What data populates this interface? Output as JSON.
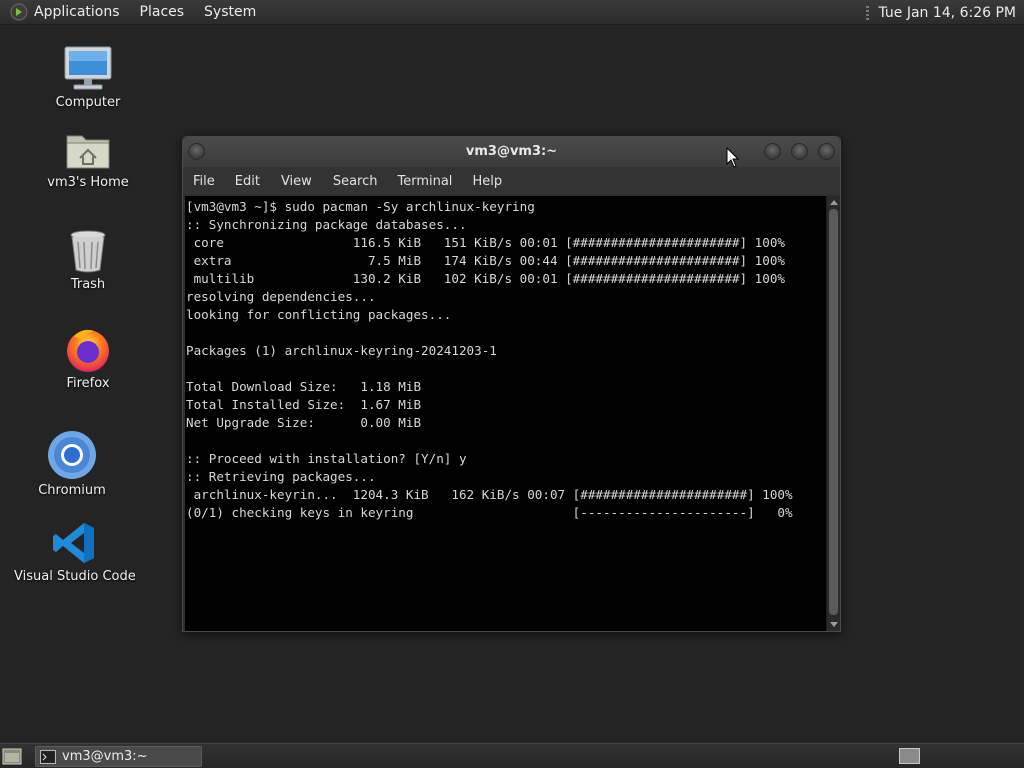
{
  "top_panel": {
    "logo_icon": "gnome-foot-icon",
    "menus": [
      "Applications",
      "Places",
      "System"
    ],
    "clock": "Tue Jan 14,  6:26 PM"
  },
  "desktop_icons": [
    {
      "label": "Computer",
      "icon": "computer-icon"
    },
    {
      "label": "vm3's Home",
      "icon": "home-folder-icon"
    },
    {
      "label": "Trash",
      "icon": "trash-icon"
    },
    {
      "label": "Firefox",
      "icon": "firefox-icon"
    },
    {
      "label": "Chromium",
      "icon": "chromium-icon"
    },
    {
      "label": "Visual Studio Code",
      "icon": "vscode-icon"
    }
  ],
  "terminal": {
    "title": "vm3@vm3:~",
    "menu": [
      "File",
      "Edit",
      "View",
      "Search",
      "Terminal",
      "Help"
    ],
    "lines": [
      "[vm3@vm3 ~]$ sudo pacman -Sy archlinux-keyring",
      ":: Synchronizing package databases...",
      " core                 116.5 KiB   151 KiB/s 00:01 [######################] 100%",
      " extra                  7.5 MiB   174 KiB/s 00:44 [######################] 100%",
      " multilib             130.2 KiB   102 KiB/s 00:01 [######################] 100%",
      "resolving dependencies...",
      "looking for conflicting packages...",
      "",
      "Packages (1) archlinux-keyring-20241203-1",
      "",
      "Total Download Size:   1.18 MiB",
      "Total Installed Size:  1.67 MiB",
      "Net Upgrade Size:      0.00 MiB",
      "",
      ":: Proceed with installation? [Y/n] y",
      ":: Retrieving packages...",
      " archlinux-keyrin...  1204.3 KiB   162 KiB/s 00:07 [######################] 100%",
      "(0/1) checking keys in keyring                     [----------------------]   0%"
    ]
  },
  "taskbar": {
    "window_button": "vm3@vm3:~"
  },
  "colors": {
    "desktop_bg": "#242424",
    "terminal_bg": "#000000",
    "terminal_fg": "#d8d8d8"
  }
}
